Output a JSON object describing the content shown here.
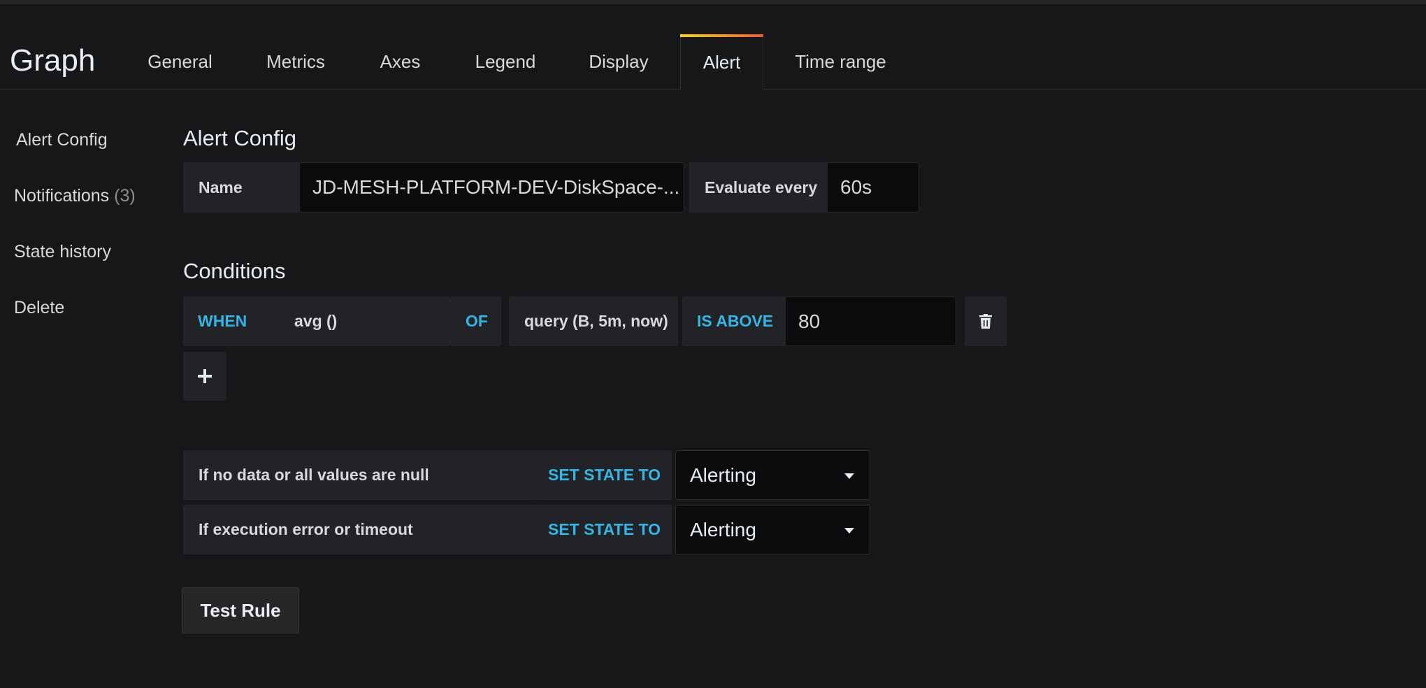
{
  "panel": {
    "title": "Graph"
  },
  "tabs": [
    {
      "label": "General"
    },
    {
      "label": "Metrics"
    },
    {
      "label": "Axes"
    },
    {
      "label": "Legend"
    },
    {
      "label": "Display"
    },
    {
      "label": "Alert"
    },
    {
      "label": "Time range"
    }
  ],
  "active_tab": "Alert",
  "sidebar": {
    "items": [
      {
        "label": "Alert Config"
      },
      {
        "label": "Notifications",
        "count": "(3)"
      },
      {
        "label": "State history"
      },
      {
        "label": "Delete"
      }
    ]
  },
  "alert_config": {
    "title": "Alert Config",
    "name_label": "Name",
    "name_value": "JD-MESH-PLATFORM-DEV-DiskSpace-...",
    "evaluate_label": "Evaluate every",
    "evaluate_value": "60s"
  },
  "conditions": {
    "title": "Conditions",
    "when_label": "WHEN",
    "reducer": "avg ()",
    "of_label": "OF",
    "query": "query (B, 5m, now)",
    "evaluator": "IS ABOVE",
    "threshold": "80",
    "delete_icon": "trash-icon",
    "add_icon": "plus-icon"
  },
  "no_data": {
    "label": "If no data or all values are null",
    "set_state_label": "SET STATE TO",
    "value": "Alerting"
  },
  "exec_error": {
    "label": "If execution error or timeout",
    "set_state_label": "SET STATE TO",
    "value": "Alerting"
  },
  "test_rule": {
    "label": "Test Rule"
  },
  "colors": {
    "keyword": "#33b5e5",
    "background": "#161719",
    "tab_accent_start": "#ffd500",
    "tab_accent_end": "#f05a28"
  }
}
